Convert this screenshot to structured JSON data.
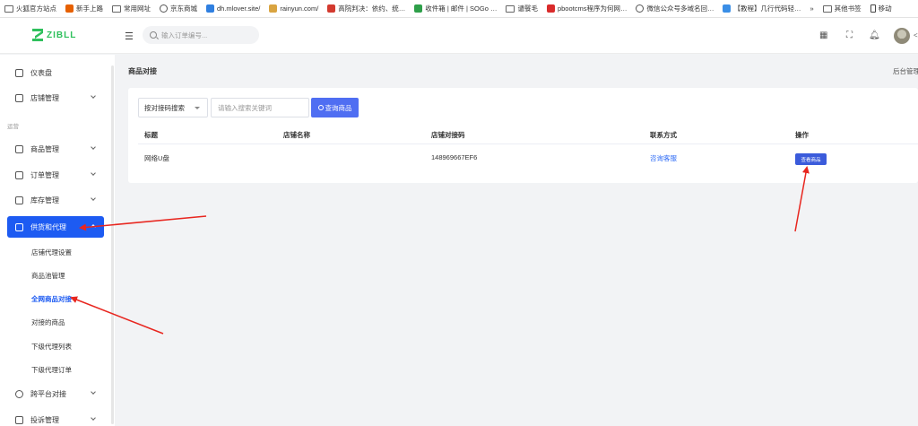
{
  "bookmarks": [
    {
      "label": "火狐官方站点",
      "icon": "folder",
      "color": "#666666"
    },
    {
      "label": "新手上路",
      "icon": "firefox",
      "color": "#e66000"
    },
    {
      "label": "常用网址",
      "icon": "folder",
      "color": "#666666"
    },
    {
      "label": "京东商城",
      "icon": "globe",
      "color": "#555555"
    },
    {
      "label": "dh.mlover.site/",
      "icon": "d-logo",
      "color": "#2f7fe0"
    },
    {
      "label": "rainyun.com/",
      "icon": "rain",
      "color": "#d9a441"
    },
    {
      "label": "高院判决：依约、统…",
      "icon": "circle-red",
      "color": "#d33a2f"
    },
    {
      "label": "收件箱 | 邮件 | SOGo …",
      "icon": "circle-green",
      "color": "#2e9f49"
    },
    {
      "label": "谴餮毛",
      "icon": "folder",
      "color": "#666666"
    },
    {
      "label": "pbootcms程序为何网…",
      "icon": "51-logo",
      "color": "#d92b2b"
    },
    {
      "label": "微信公众号多域名回…",
      "icon": "globe",
      "color": "#555555"
    },
    {
      "label": "【教程】几行代码轻…",
      "icon": "cloud",
      "color": "#3a8ee6"
    },
    {
      "label": "其他书签",
      "icon": "folder",
      "color": "#666666"
    },
    {
      "label": "移动",
      "icon": "phone",
      "color": "#444444"
    }
  ],
  "bookmarks_more": "»",
  "header": {
    "logo_text": "ZIBLL",
    "search_placeholder": "输入订单编号...",
    "avatar_text": "<"
  },
  "sidebar": {
    "section_label": "运营",
    "items": [
      {
        "label": "仪表盘"
      },
      {
        "label": "店铺管理"
      },
      {
        "label": "商品管理"
      },
      {
        "label": "订单管理"
      },
      {
        "label": "库存管理"
      },
      {
        "label": "供货和代理"
      },
      {
        "label": "跨平台对接"
      },
      {
        "label": "投诉管理"
      }
    ],
    "sub_items": [
      {
        "label": "店铺代理设置"
      },
      {
        "label": "商品池管理"
      },
      {
        "label": "全网商品对接"
      },
      {
        "label": "对接的商品"
      },
      {
        "label": "下级代理列表"
      },
      {
        "label": "下级代理订单"
      }
    ]
  },
  "main": {
    "page_title": "商品对接",
    "breadcrumb": "后台管理",
    "filter": {
      "select_value": "按对接码搜索",
      "keyword_placeholder": "请输入搜索关键词",
      "query_button": "查询商品"
    },
    "table": {
      "headers": [
        "标题",
        "店铺名称",
        "店铺对接码",
        "联系方式",
        "操作"
      ],
      "rows": [
        {
          "title": "网络U盘",
          "shop_name": "",
          "code": "148969667EF6",
          "contact": "咨询客服",
          "action": "查看商品"
        }
      ]
    }
  },
  "colors": {
    "accent": "#1d5bf2",
    "button": "#4f6ef2",
    "brand": "#2ec05c",
    "arrow": "#e8261f"
  }
}
